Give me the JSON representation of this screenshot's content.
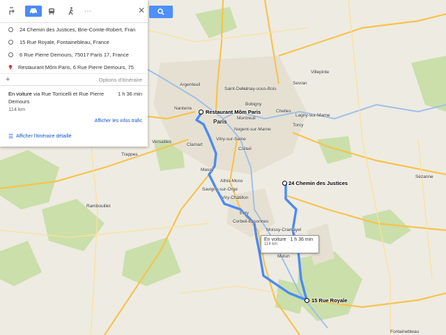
{
  "panel": {
    "waypoints": [
      {
        "text": "24 Chemin des Justices, Brie-Comte-Robert, Fran",
        "icon": "circle-icon"
      },
      {
        "text": "15 Rue Royale, Fontainebleau, France",
        "icon": "circle-icon"
      },
      {
        "text": "6 Rue Pierre Demours, 75017 Paris 17, France",
        "icon": "circle-icon"
      },
      {
        "text": "Restaurant Mõm Paris, 6 Rue Pierre Demours, 75",
        "icon": "red-pin-icon"
      }
    ],
    "add_symbol": "+",
    "options_label": "Options d'itinéraire",
    "route": {
      "mode": "En voiture",
      "via": "via Rue Torricelli et Rue Pierre Demours",
      "time": "1 h 36 min",
      "distance": "114 km"
    },
    "traffic_label": "Afficher les infos trafic",
    "details_label": "Afficher l'itinéraire détaillé"
  },
  "map": {
    "markers": [
      {
        "name": "Restaurant Mõm Paris"
      },
      {
        "name": "24 Chemin des Justices"
      },
      {
        "name": "15 Rue Royale"
      }
    ],
    "callout": {
      "mode": "En voiture",
      "time": "1 h 36 min",
      "distance": "114 km"
    },
    "route_color": "#4a8af4",
    "places": [
      "Paris",
      "Argenteuil",
      "Saint-Denis",
      "Sevran",
      "Aulnay-sous-Bois",
      "Villepinte",
      "Nanterre",
      "Bobigny",
      "Chelles",
      "Montreuil",
      "Nogent-sur-Marne",
      "Versailles",
      "Clamart",
      "Créteil",
      "Vitry-sur-Seine",
      "Torcy",
      "Lagny-sur-Marne",
      "Massy",
      "Athis-Mons",
      "Savigny-sur-Orge",
      "Viry-Châtillon",
      "Evry",
      "Corbeil-Essonnes",
      "Melun",
      "Rambouillet",
      "Trappes",
      "Fontainebleau",
      "Moissy-Cramayel",
      "Sézanne"
    ]
  }
}
